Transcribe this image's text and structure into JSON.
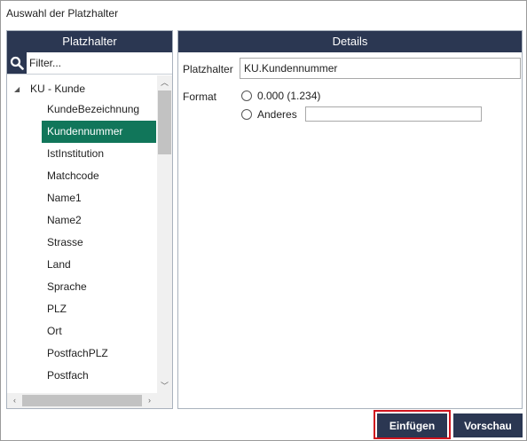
{
  "window": {
    "title": "Auswahl der Platzhalter"
  },
  "left_panel": {
    "header": "Platzhalter",
    "filter_placeholder": "Filter...",
    "tree": {
      "root_label": "KU - Kunde",
      "items": [
        {
          "label": "KundeBezeichnung",
          "selected": false
        },
        {
          "label": "Kundennummer",
          "selected": true
        },
        {
          "label": "IstInstitution",
          "selected": false
        },
        {
          "label": "Matchcode",
          "selected": false
        },
        {
          "label": "Name1",
          "selected": false
        },
        {
          "label": "Name2",
          "selected": false
        },
        {
          "label": "Strasse",
          "selected": false
        },
        {
          "label": "Land",
          "selected": false
        },
        {
          "label": "Sprache",
          "selected": false
        },
        {
          "label": "PLZ",
          "selected": false
        },
        {
          "label": "Ort",
          "selected": false
        },
        {
          "label": "PostfachPLZ",
          "selected": false
        },
        {
          "label": "Postfach",
          "selected": false
        }
      ]
    }
  },
  "details": {
    "header": "Details",
    "placeholder_label": "Platzhalter",
    "placeholder_value": "KU.Kundennummer",
    "format_label": "Format",
    "format_options": [
      "0.000 (1.234)",
      "Anderes"
    ],
    "custom_format_value": ""
  },
  "buttons": {
    "insert": "Einfügen",
    "preview": "Vorschau"
  },
  "colors": {
    "header_bg": "#2b3752",
    "selection": "#11765a",
    "highlight_border": "#d0141e"
  }
}
